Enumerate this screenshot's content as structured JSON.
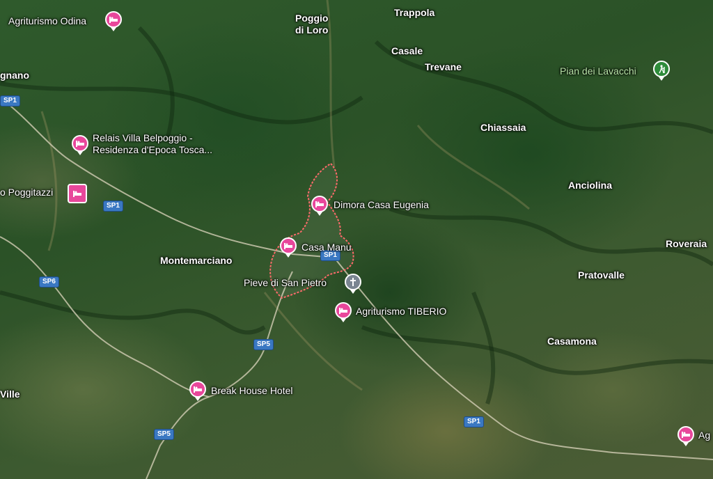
{
  "colors": {
    "hotel_pin": "#e8479b",
    "church_pin": "#7a8591",
    "park_pin": "#2e8b3a",
    "road_shield": "#3a78c2",
    "boundary": "#ff6b6b"
  },
  "places": {
    "poggio_di_loro_line1": "Poggio",
    "poggio_di_loro_line2": "di Loro",
    "trappola": "Trappola",
    "casale": "Casale",
    "trevane": "Trevane",
    "chiassaia": "Chiassaia",
    "anciolina": "Anciolina",
    "roveraia": "Roveraia",
    "pratovalle": "Pratovalle",
    "casamona": "Casamona",
    "montemarciano": "Montemarciano",
    "gnano": "gnano",
    "ville": "Ville"
  },
  "pois": {
    "agriturismo_odina": "Agriturismo Odina",
    "pian_dei_lavacchi": "Pian dei Lavacchi",
    "relais_line1": "Relais Villa Belpoggio -",
    "relais_line2": "Residenza d'Epoca Tosca...",
    "poggitazzi": "o Poggitazzi",
    "dimora_casa_eugenia": "Dimora Casa Eugenia",
    "casa_manu": "Casa Manu",
    "pieve_di_san_pietro": "Pieve di San Pietro",
    "agriturismo_tiberio": "Agriturismo TIBERIO",
    "break_house_hotel": "Break House Hotel",
    "edge_ag": "Ag"
  },
  "roads": {
    "sp1_a": "SP1",
    "sp1_b": "SP1",
    "sp1_c": "SP1",
    "sp1_d": "SP1",
    "sp5_a": "SP5",
    "sp5_b": "SP5",
    "sp6": "SP6"
  },
  "icons": {
    "hotel": "bed-icon",
    "church": "cross-icon",
    "park": "hiker-icon"
  }
}
